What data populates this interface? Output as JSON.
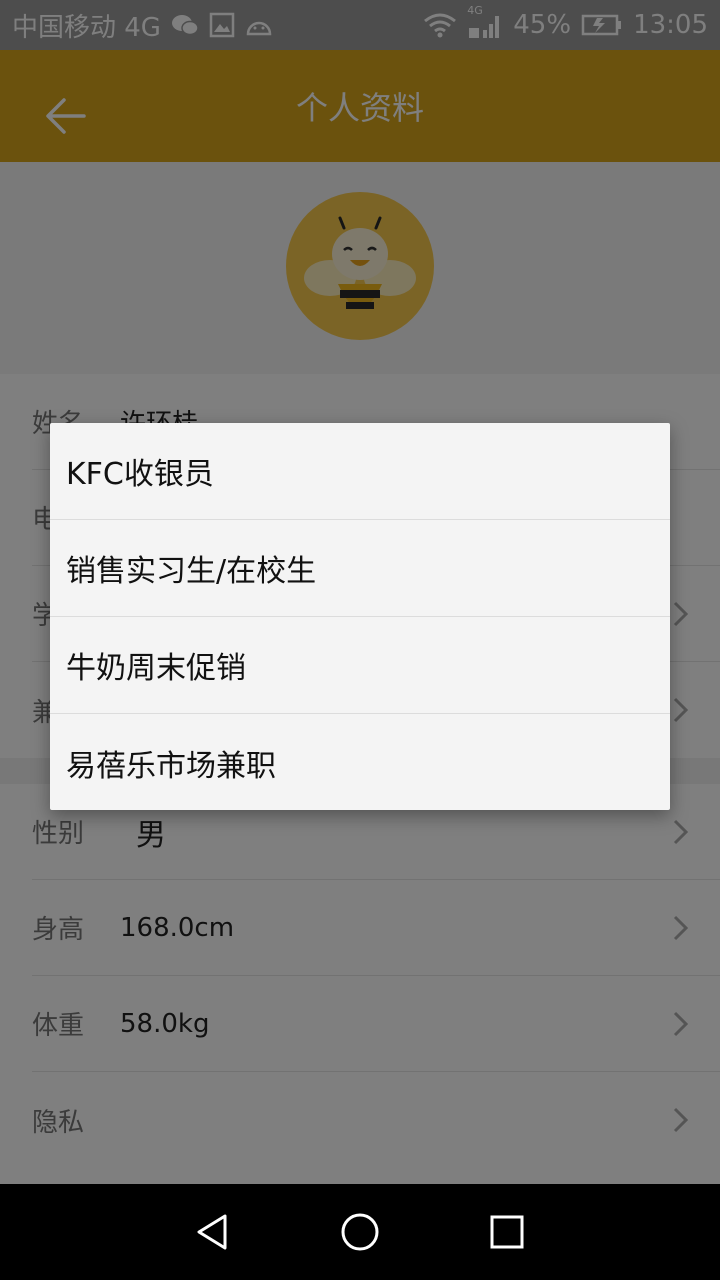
{
  "status_bar": {
    "carrier": "中国移动 4G",
    "network_small": "4G",
    "battery_percent": "45%",
    "time": "13:05"
  },
  "app_bar": {
    "title": "个人资料"
  },
  "profile": {
    "name_label": "姓名",
    "name_value": "许环桂",
    "phone_label": "电",
    "school_label": "学",
    "parttime_label": "兼"
  },
  "details": {
    "gender_label": "性别",
    "gender_value": "男",
    "height_label": "身高",
    "height_value": "168.0cm",
    "weight_label": "体重",
    "weight_value": "58.0kg",
    "privacy_label": "隐私"
  },
  "dialog": {
    "options": [
      "KFC收银员",
      "销售实习生/在校生",
      "牛奶周末促销",
      "易蓓乐市场兼职"
    ]
  },
  "colors": {
    "accent": "#d6a51b",
    "avatar_bg": "#f7c84c"
  }
}
